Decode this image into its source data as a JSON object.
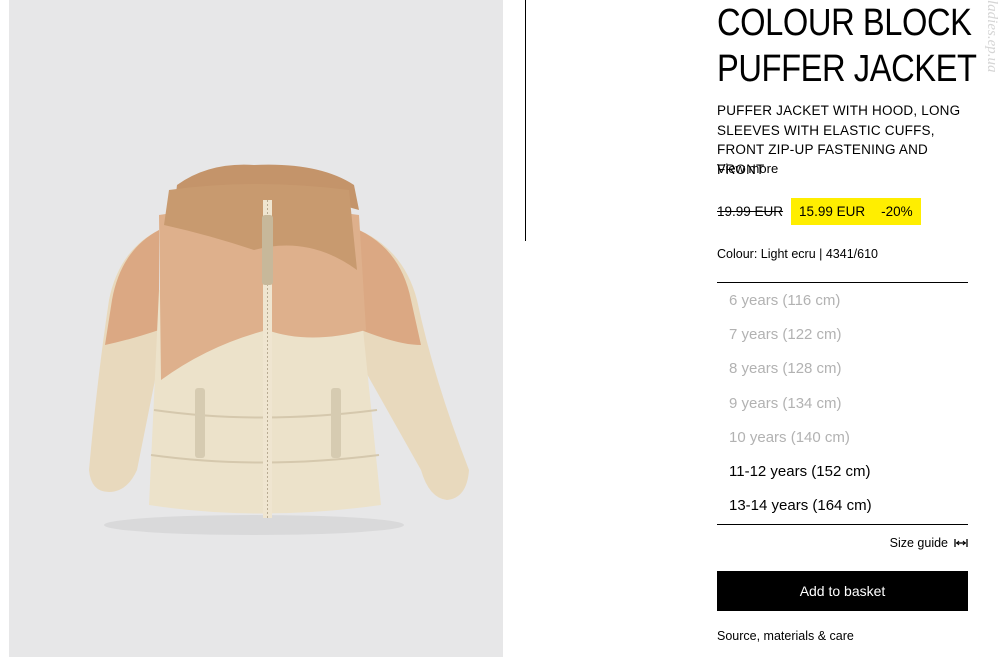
{
  "product": {
    "title_line1": "COLOUR BLOCK",
    "title_line2": "PUFFER JACKET",
    "description": "PUFFER JACKET WITH HOOD, LONG SLEEVES WITH ELASTIC CUFFS, FRONT ZIP-UP FASTENING AND FRONT",
    "view_more": "View more",
    "old_price": "19.99 EUR",
    "new_price": "15.99 EUR",
    "discount": "-20%",
    "colour_line": "Colour: Light ecru | 4341/610",
    "image_alt": "Colour block puffer jacket"
  },
  "sizes": [
    {
      "label": "6 years (116 cm)",
      "available": false
    },
    {
      "label": "7 years (122 cm)",
      "available": false
    },
    {
      "label": "8 years (128 cm)",
      "available": false
    },
    {
      "label": "9 years (134 cm)",
      "available": false
    },
    {
      "label": "10 years (140 cm)",
      "available": false
    },
    {
      "label": "11-12 years (152 cm)",
      "available": true
    },
    {
      "label": "13-14 years (164 cm)",
      "available": true
    }
  ],
  "actions": {
    "size_guide": "Size guide",
    "add_to_basket": "Add to basket",
    "source": "Source, materials & care"
  },
  "watermark": "ladies.ep.ua",
  "colors": {
    "price_highlight": "#ffee00",
    "button_bg": "#000000",
    "disabled_text": "#b2b2b2"
  }
}
